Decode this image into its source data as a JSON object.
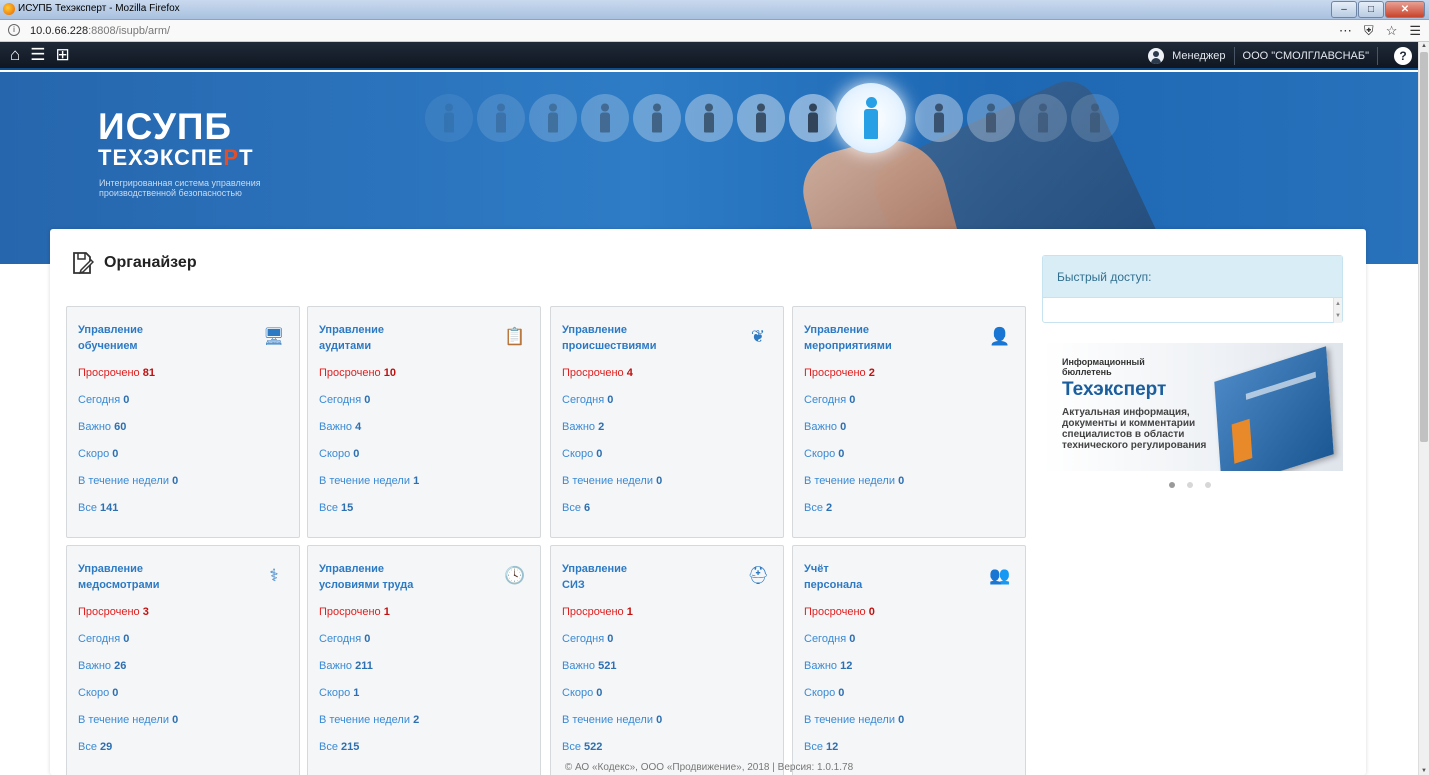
{
  "browser": {
    "title": "ИСУПБ Техэксперт - Mozilla Firefox",
    "url_host": "10.0.66.228",
    "url_rest": ":8808/isupb/arm/"
  },
  "navbar": {
    "role": "Менеджер",
    "organization": "ООО \"СМОЛГЛАВСНАБ\""
  },
  "banner": {
    "logo_main": "ИСУПБ",
    "logo_sub_a": "ТЕХЭКСПЕ",
    "logo_sub_r": "Р",
    "logo_sub_b": "Т",
    "description": "Интегрированная система управления производственной безопасностью"
  },
  "organizer": {
    "title": "Органайзер",
    "labels": {
      "overdue": "Просрочено",
      "today": "Сегодня",
      "important": "Важно",
      "soon": "Скоро",
      "week": "В течение недели",
      "all": "Все"
    },
    "cards": [
      {
        "title_1": "Управление",
        "title_2": "обучением",
        "icon": "training-icon",
        "overdue": "81",
        "today": "0",
        "important": "60",
        "soon": "0",
        "week": "0",
        "all": "141"
      },
      {
        "title_1": "Управление",
        "title_2": "аудитами",
        "icon": "audit-icon",
        "overdue": "10",
        "today": "0",
        "important": "4",
        "soon": "0",
        "week": "1",
        "all": "15"
      },
      {
        "title_1": "Управление",
        "title_2": "происшествиями",
        "icon": "incident-icon",
        "overdue": "4",
        "today": "0",
        "important": "2",
        "soon": "0",
        "week": "0",
        "all": "6"
      },
      {
        "title_1": "Управление",
        "title_2": "мероприятиями",
        "icon": "events-icon",
        "overdue": "2",
        "today": "0",
        "important": "0",
        "soon": "0",
        "week": "0",
        "all": "2"
      },
      {
        "title_1": "Управление",
        "title_2": "медосмотрами",
        "icon": "medical-icon",
        "overdue": "3",
        "today": "0",
        "important": "26",
        "soon": "0",
        "week": "0",
        "all": "29"
      },
      {
        "title_1": "Управление",
        "title_2": "условиями труда",
        "icon": "work-conditions-icon",
        "overdue": "1",
        "today": "0",
        "important": "211",
        "soon": "1",
        "week": "2",
        "all": "215"
      },
      {
        "title_1": "Управление",
        "title_2": "СИЗ",
        "icon": "ppe-helmet-icon",
        "overdue": "1",
        "today": "0",
        "important": "521",
        "soon": "0",
        "week": "0",
        "all": "522"
      },
      {
        "title_1": "Учёт",
        "title_2": "персонала",
        "icon": "staff-icon",
        "overdue": "0",
        "today": "0",
        "important": "12",
        "soon": "0",
        "week": "0",
        "all": "12"
      }
    ]
  },
  "quick_access": {
    "title": "Быстрый доступ:"
  },
  "bulletin": {
    "line1": "Информационный бюллетень",
    "brand": "Техэксперт",
    "text": "Актуальная информация, документы и комментарии специалистов в области технического регулирования"
  },
  "footer": "© АО «Кодекс», ООО «Продвижение», 2018 | Версия: 1.0.1.78"
}
